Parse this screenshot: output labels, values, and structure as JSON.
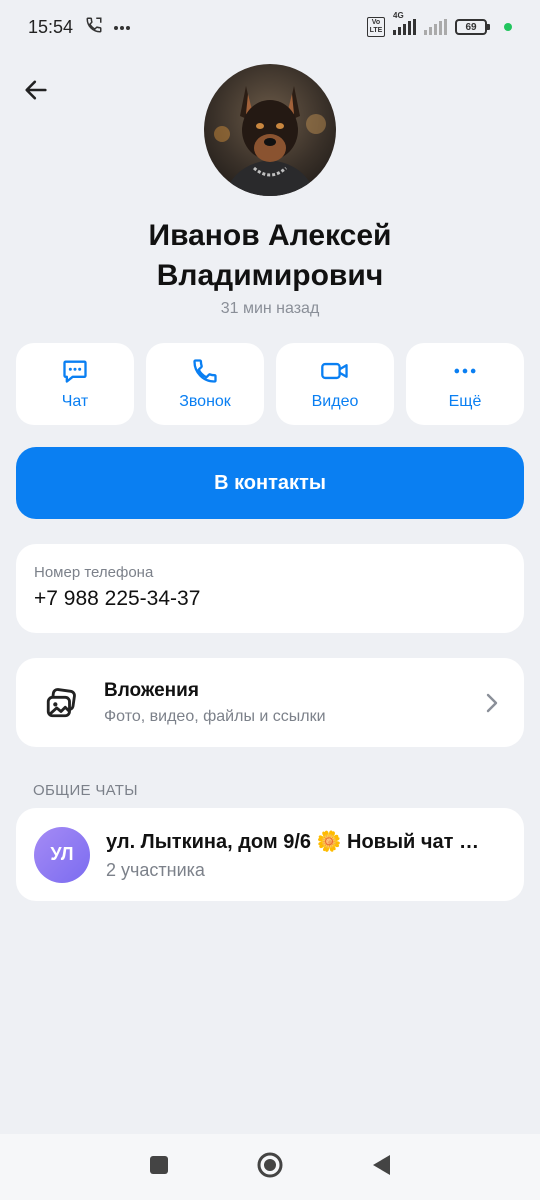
{
  "status": {
    "time": "15:54",
    "network": "4G",
    "volte": "Vo LTE",
    "battery": "69"
  },
  "profile": {
    "name": "Иванов Алексей Владимирович",
    "last_seen": "31 мин назад"
  },
  "actions": [
    {
      "label": "Чат",
      "icon": "chat-icon"
    },
    {
      "label": "Звонок",
      "icon": "phone-icon"
    },
    {
      "label": "Видео",
      "icon": "video-icon"
    },
    {
      "label": "Ещё",
      "icon": "more-icon"
    }
  ],
  "add_contact_label": "В контакты",
  "phone": {
    "label": "Номер телефона",
    "value": "+7 988 225-34-37"
  },
  "attachments": {
    "title": "Вложения",
    "subtitle": "Фото, видео, файлы и ссылки"
  },
  "common_chats": {
    "section_title": "ОБЩИЕ ЧАТЫ",
    "items": [
      {
        "initials": "УЛ",
        "title": "ул. Лыткина, дом 9/6 🌼 Новый чат …",
        "subtitle": "2 участника"
      }
    ]
  },
  "colors": {
    "accent": "#0a7ff2",
    "background": "#eef0f4",
    "avatar_gradient": "#8f7cf2"
  }
}
